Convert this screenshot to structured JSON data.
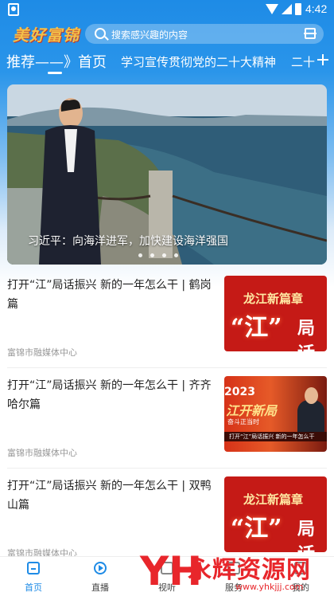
{
  "status_bar": {
    "time": "4:42"
  },
  "header": {
    "logo_text": "美好富锦",
    "search_placeholder": "搜索感兴趣的内容",
    "icons": {
      "search": "search-icon",
      "scan": "scan-icon",
      "add": "plus-icon"
    }
  },
  "tabs": [
    {
      "label": "推荐——》首页",
      "active": true
    },
    {
      "label": "学习宣传贯彻党的二十大精神",
      "active": false
    },
    {
      "label": "二十",
      "active": false
    }
  ],
  "banner": {
    "caption": "习近平：向海洋进军，加快建设海洋强国",
    "page_count": 4,
    "current_page": 1
  },
  "news": [
    {
      "title": "打开“江”局话振兴 新的一年怎么干 | 鹤岗篇",
      "source": "富锦市融媒体中心",
      "thumb": {
        "style": "red",
        "line1": "龙江新篇章",
        "line2": "“江”",
        "line3": "局话"
      }
    },
    {
      "title": "打开“江”局话振兴 新的一年怎么干 | 齐齐哈尔篇",
      "source": "富锦市融媒体中心",
      "thumb": {
        "style": "tv",
        "year": "2023",
        "head": "江开新局",
        "sub": "奋斗正当时",
        "bar": "打开“江”局话振兴 新的一年怎么干"
      }
    },
    {
      "title": "打开“江”局话振兴 新的一年怎么干 | 双鸭山篇",
      "source": "富锦市融媒体中心",
      "thumb": {
        "style": "red",
        "line1": "龙江新篇章",
        "line2": "“江”",
        "line3": "局话"
      }
    }
  ],
  "bottom_nav": [
    {
      "label": "首页",
      "icon": "home-icon",
      "active": true
    },
    {
      "label": "直播",
      "icon": "live-icon",
      "active": false
    },
    {
      "label": "视听",
      "icon": "video-icon",
      "active": false
    },
    {
      "label": "服务",
      "icon": "service-icon",
      "active": false
    },
    {
      "label": "我的",
      "icon": "profile-icon",
      "active": false
    }
  ],
  "watermark": {
    "logo": "YH",
    "text": "永辉资源网",
    "url": "www.yhkjjj.com"
  },
  "colors": {
    "brand_blue": "#1e8be6",
    "news_red": "#c51a16",
    "watermark_red": "#e8262b"
  }
}
